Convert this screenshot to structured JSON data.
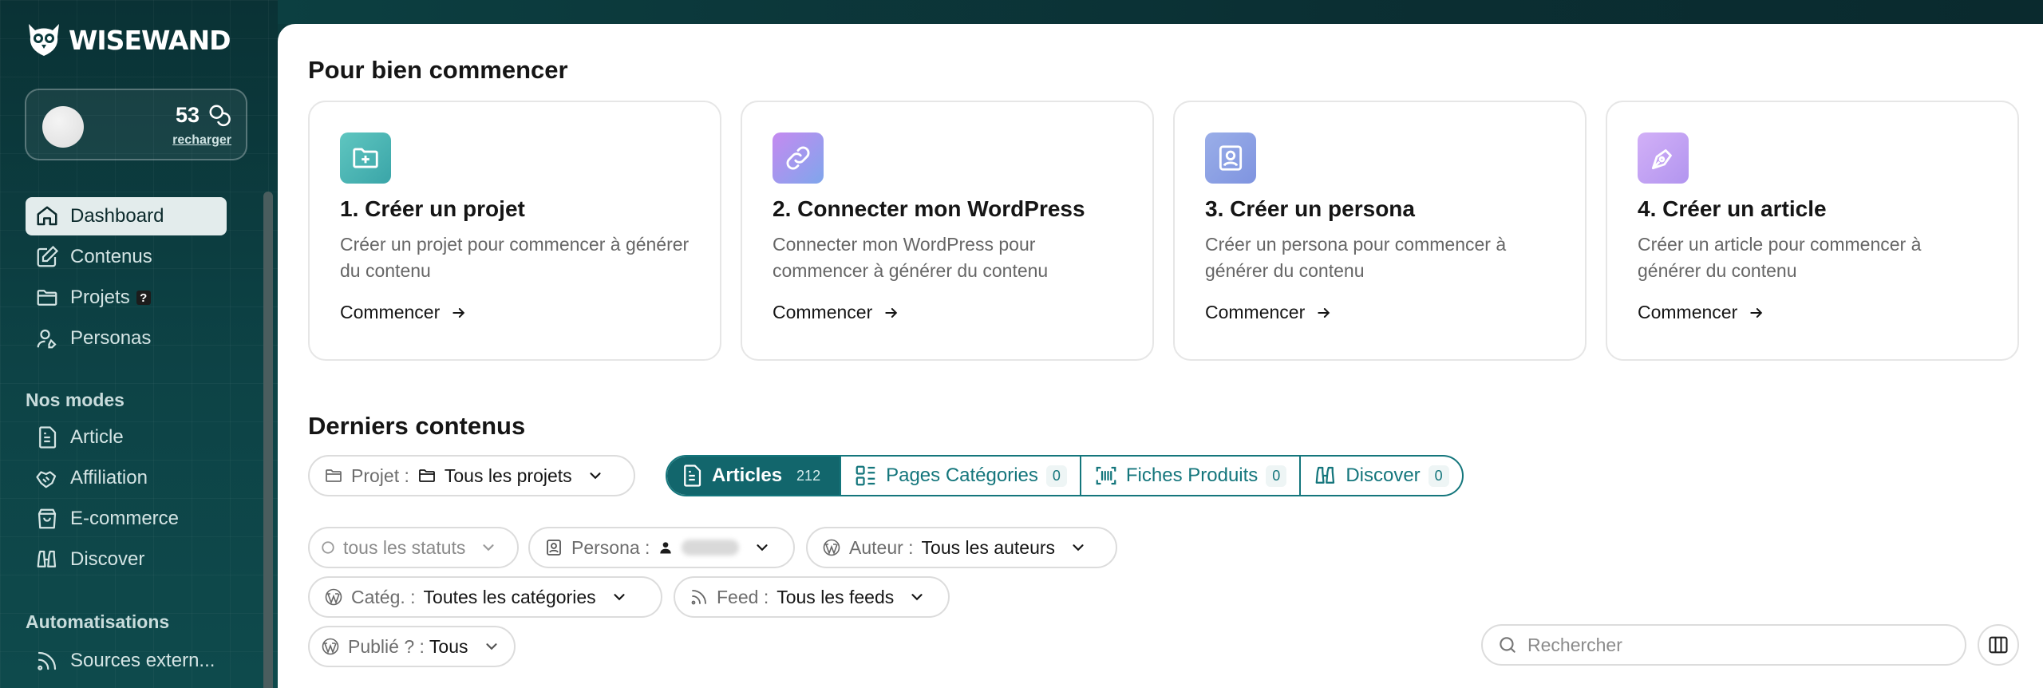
{
  "brand": {
    "name": "WISEWAND"
  },
  "account": {
    "credits": "53",
    "recharge_label": "recharger"
  },
  "sidebar": {
    "items": [
      {
        "label": "Dashboard",
        "icon": "home-icon",
        "active": true
      },
      {
        "label": "Contenus",
        "icon": "edit-icon"
      },
      {
        "label": "Projets",
        "icon": "folder-icon",
        "badge": "?"
      },
      {
        "label": "Personas",
        "icon": "user-pen-icon"
      }
    ],
    "modes_title": "Nos modes",
    "modes": [
      {
        "label": "Article",
        "icon": "file-text-icon"
      },
      {
        "label": "Affiliation",
        "icon": "handshake-icon"
      },
      {
        "label": "E-commerce",
        "icon": "shopping-bag-icon"
      },
      {
        "label": "Discover",
        "icon": "binoculars-icon"
      }
    ],
    "automation_title": "Automatisations",
    "automations": [
      {
        "label": "Sources extern...",
        "icon": "rss-icon"
      }
    ]
  },
  "getting_started": {
    "title": "Pour bien commencer",
    "steps": [
      {
        "title": "1. Créer un projet",
        "desc": "Créer un projet pour commencer à générer du contenu",
        "cta": "Commencer",
        "icon": "folder-plus-icon",
        "color": "#3fb5b0"
      },
      {
        "title": "2. Connecter mon WordPress",
        "desc": "Connecter mon WordPress pour commencer à générer du contenu",
        "cta": "Commencer",
        "icon": "link-icon",
        "color": "#a78bfa"
      },
      {
        "title": "3. Créer un persona",
        "desc": "Créer un persona pour commencer à générer du contenu",
        "cta": "Commencer",
        "icon": "contact-icon",
        "color": "#8fa2e8"
      },
      {
        "title": "4. Créer un article",
        "desc": "Créer un article pour commencer à générer du contenu",
        "cta": "Commencer",
        "icon": "pen-tool-icon",
        "color": "#c4a3f5"
      }
    ]
  },
  "latest": {
    "title": "Derniers contenus",
    "project_filter": {
      "label": "Projet :",
      "value": "Tous les projets"
    },
    "tabs": [
      {
        "label": "Articles",
        "count": "212",
        "icon": "file-text-icon",
        "active": true
      },
      {
        "label": "Pages Catégories",
        "count": "0",
        "icon": "layout-list-icon"
      },
      {
        "label": "Fiches Produits",
        "count": "0",
        "icon": "barcode-icon"
      },
      {
        "label": "Discover",
        "count": "0",
        "icon": "binoculars-icon"
      }
    ],
    "filters": {
      "status": {
        "value": "tous les statuts"
      },
      "persona": {
        "label": "Persona :"
      },
      "author": {
        "label": "Auteur :",
        "value": "Tous les auteurs"
      },
      "category": {
        "label": "Catég. :",
        "value": "Toutes les catégories"
      },
      "feed": {
        "label": "Feed :",
        "value": "Tous les feeds"
      },
      "published": {
        "label": "Publié ? :",
        "value": "Tous"
      }
    },
    "search": {
      "placeholder": "Rechercher"
    }
  },
  "colors": {
    "accent": "#12666c",
    "sidebar": "#0b3a3c"
  }
}
